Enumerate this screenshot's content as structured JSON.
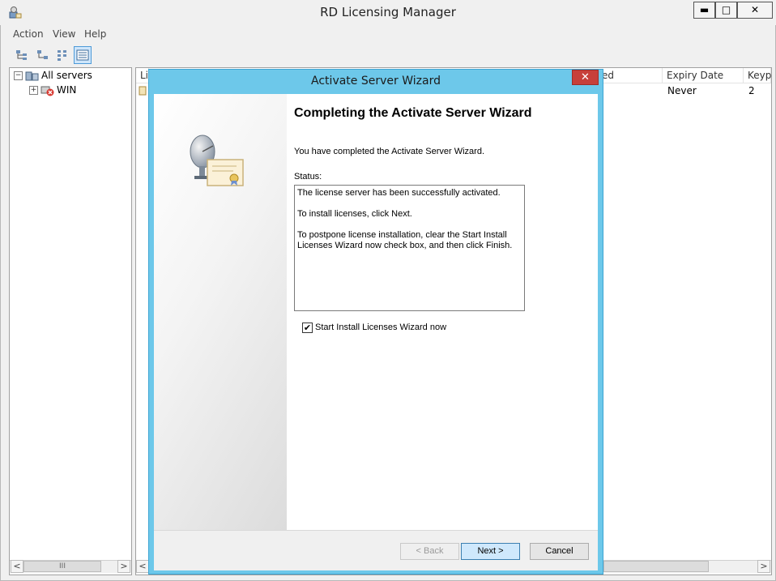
{
  "window": {
    "title": "RD Licensing Manager",
    "minimize": "▬",
    "maximize": "□",
    "close": "✕"
  },
  "menu": [
    "Action",
    "View",
    "Help"
  ],
  "toolbar": [
    "tree-view-icon",
    "tree-collapse-icon",
    "details-icon",
    "list-view-icon"
  ],
  "tree": {
    "root_label": "All servers",
    "root_expander": "−",
    "child_label": "WIN",
    "child_expander": "+"
  },
  "list": {
    "columns": [
      "Li",
      "ed",
      "Expiry Date",
      "Keyp"
    ],
    "row": {
      "expiry": "Never",
      "keypacks": "2"
    }
  },
  "scroll": {
    "left": "<",
    "right": ">",
    "thumb": "III"
  },
  "wizard": {
    "title": "Activate Server Wizard",
    "close": "✕",
    "heading": "Completing the Activate Server Wizard",
    "description": "You have completed the Activate Server Wizard.",
    "status_label": "Status:",
    "status_lines": [
      "The license server has been successfully activated.",
      "To install licenses, click Next.",
      "To postpone license installation, clear the Start Install Licenses Wizard now check box, and then click Finish."
    ],
    "checkbox_label": "Start Install Licenses Wizard now",
    "checkbox_mark": "✔",
    "checkbox_checked": true,
    "back": "< Back",
    "next": "Next >",
    "cancel": "Cancel"
  },
  "colors": {
    "wizard_frame": "#6dc8ea",
    "close_red": "#c7403a",
    "primary_button": "#cfe8fc"
  }
}
